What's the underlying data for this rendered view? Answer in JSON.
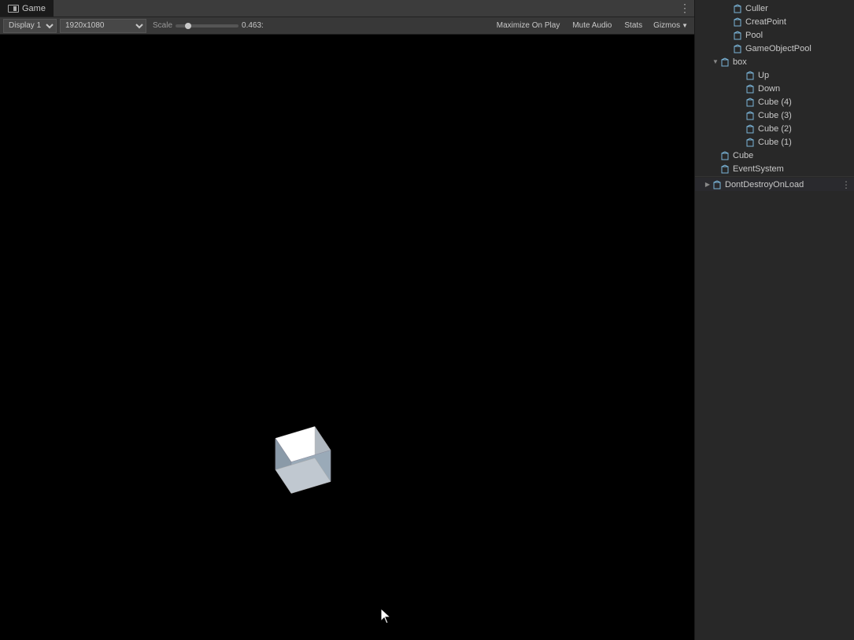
{
  "game_panel": {
    "tab_label": "Game",
    "more_button": "⋮",
    "toolbar": {
      "display_label": "Display 1",
      "resolution_label": "1920x1080",
      "scale_label": "Scale",
      "scale_value": "0.463:",
      "maximize_on_play": "Maximize On Play",
      "mute_audio": "Mute Audio",
      "stats": "Stats",
      "gizmos": "Gizmos"
    }
  },
  "hierarchy": {
    "items": [
      {
        "id": "culler",
        "label": "Culler",
        "indent": 2,
        "expand": "empty",
        "icon": "cube"
      },
      {
        "id": "creatpoint",
        "label": "CreatPoint",
        "indent": 2,
        "expand": "empty",
        "icon": "cube"
      },
      {
        "id": "pool",
        "label": "Pool",
        "indent": 2,
        "expand": "empty",
        "icon": "cube"
      },
      {
        "id": "gameobjectpool",
        "label": "GameObjectPool",
        "indent": 2,
        "expand": "empty",
        "icon": "cube"
      },
      {
        "id": "box",
        "label": "box",
        "indent": 1,
        "expand": "expanded",
        "icon": "cube"
      },
      {
        "id": "up",
        "label": "Up",
        "indent": 3,
        "expand": "empty",
        "icon": "cube"
      },
      {
        "id": "down",
        "label": "Down",
        "indent": 3,
        "expand": "empty",
        "icon": "cube"
      },
      {
        "id": "cube4",
        "label": "Cube (4)",
        "indent": 3,
        "expand": "empty",
        "icon": "cube"
      },
      {
        "id": "cube3",
        "label": "Cube (3)",
        "indent": 3,
        "expand": "empty",
        "icon": "cube"
      },
      {
        "id": "cube2",
        "label": "Cube (2)",
        "indent": 3,
        "expand": "empty",
        "icon": "cube"
      },
      {
        "id": "cube1",
        "label": "Cube (1)",
        "indent": 3,
        "expand": "empty",
        "icon": "cube"
      },
      {
        "id": "cube",
        "label": "Cube",
        "indent": 1,
        "expand": "empty",
        "icon": "cube"
      },
      {
        "id": "eventsystem",
        "label": "EventSystem",
        "indent": 1,
        "expand": "empty",
        "icon": "cube"
      },
      {
        "id": "dontdestroy",
        "label": "DontDestroyOnLoad",
        "indent": 0,
        "expand": "collapsed",
        "icon": "cube",
        "special": true
      }
    ]
  }
}
